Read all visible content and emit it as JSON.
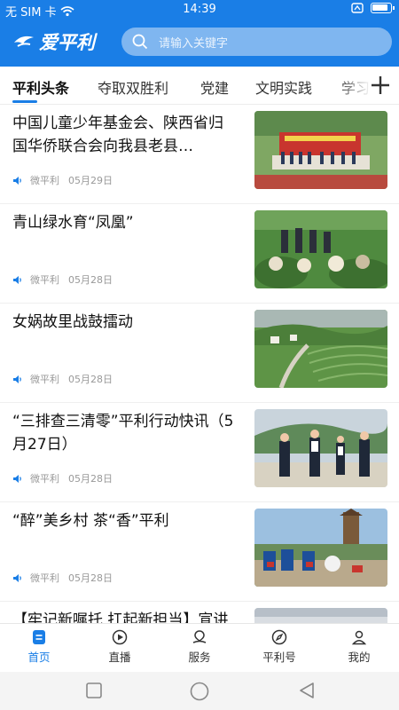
{
  "status_bar": {
    "carrier": "无 SIM 卡",
    "time": "14:39"
  },
  "app": {
    "logo_text": "爱平利"
  },
  "search": {
    "placeholder": "请输入关键字"
  },
  "tabs": [
    {
      "label": "平利头条",
      "active": true
    },
    {
      "label": "夺取双胜利",
      "active": false
    },
    {
      "label": "党建",
      "active": false
    },
    {
      "label": "文明实践",
      "active": false
    },
    {
      "label": "学习",
      "active": false
    }
  ],
  "feed": [
    {
      "title": "中国儿童少年基金会、陕西省归国华侨联合会向我县老县…",
      "source": "微平利",
      "date": "05月29日",
      "thumb_icon": "ceremony-photo"
    },
    {
      "title": "青山绿水育“凤凰”",
      "source": "微平利",
      "date": "05月28日",
      "thumb_icon": "tea-garden-visit-photo"
    },
    {
      "title": "女娲故里战鼓擂动",
      "source": "微平利",
      "date": "05月28日",
      "thumb_icon": "terraced-tea-hills-photo"
    },
    {
      "title": "“三排查三清零”平利行动快讯（5月27日）",
      "source": "微平利",
      "date": "05月28日",
      "thumb_icon": "officials-inspection-photo"
    },
    {
      "title": "“醉”美乡村 茶“香”平利",
      "source": "微平利",
      "date": "05月28日",
      "thumb_icon": "tea-festival-photo"
    },
    {
      "title": "【牢记新嘱托 扛起新担当】宣讲",
      "source": "",
      "date": "",
      "thumb_icon": "meeting-photo"
    }
  ],
  "bottom_nav": [
    {
      "label": "首页",
      "icon": "home-icon",
      "active": true
    },
    {
      "label": "直播",
      "icon": "live-icon",
      "active": false
    },
    {
      "label": "服务",
      "icon": "service-icon",
      "active": false
    },
    {
      "label": "平利号",
      "icon": "compass-icon",
      "active": false
    },
    {
      "label": "我的",
      "icon": "profile-icon",
      "active": false
    }
  ],
  "colors": {
    "brand": "#1a7ee6",
    "search_bg": "#7fb6f0",
    "meta_text": "#999999"
  }
}
